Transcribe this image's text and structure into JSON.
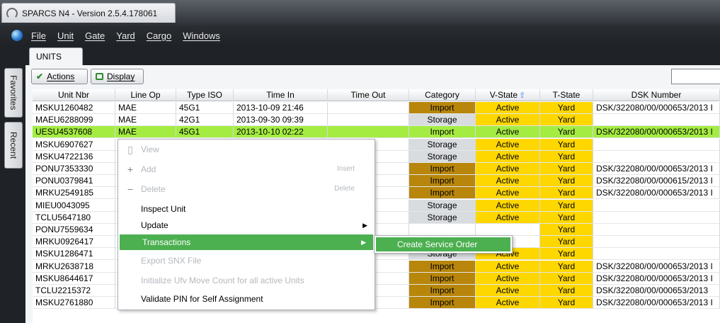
{
  "window": {
    "title": "SPARCS N4 - Version 2.5.4.178061"
  },
  "menu": [
    "File",
    "Unit",
    "Gate",
    "Yard",
    "Cargo",
    "Windows"
  ],
  "side_tabs": [
    "Favorites",
    "Recent"
  ],
  "tab": "UNITS",
  "toolbar": {
    "actions": "Actions",
    "display": "Display",
    "search_value": ""
  },
  "columns": [
    "Unit Nbr",
    "Line Op",
    "Type ISO",
    "Time In",
    "Time Out",
    "Category",
    "V-State",
    "T-State",
    "DSK Number"
  ],
  "colors": {
    "import": "#b8860b",
    "storage": "#d9dcdf",
    "active": "#ffd700",
    "selection": "#a4ec42",
    "highlight": "#4caf50"
  },
  "rows": [
    [
      "MSKU1260482",
      "MAE",
      "45G1",
      "2013-10-09 21:46",
      "",
      "Import",
      "Active",
      "Yard",
      "DSK/322080/00/000653/2013 I"
    ],
    [
      "MAEU6288099",
      "MAE",
      "42G1",
      "2013-09-30 09:39",
      "",
      "Storage",
      "Active",
      "Yard",
      ""
    ],
    [
      "UESU4537608",
      "MAE",
      "45G1",
      "2013-10-10 02:22",
      "",
      "Import",
      "Active",
      "Yard",
      "DSK/322080/00/000653/2013 I"
    ],
    [
      "MSKU6907627",
      "",
      "",
      "",
      "",
      "Storage",
      "Active",
      "Yard",
      ""
    ],
    [
      "MSKU4722136",
      "",
      "",
      "",
      "",
      "Storage",
      "Active",
      "Yard",
      ""
    ],
    [
      "PONU7353330",
      "",
      "",
      "",
      "",
      "Import",
      "Active",
      "Yard",
      "DSK/322080/00/000653/2013 I"
    ],
    [
      "PONU0379841",
      "",
      "",
      "",
      "",
      "Import",
      "Active",
      "Yard",
      "DSK/322080/00/000615/2013 I"
    ],
    [
      "MRKU2549185",
      "",
      "",
      "",
      "",
      "Import",
      "Active",
      "Yard",
      "DSK/322080/00/000653/2013 I"
    ],
    [
      "MIEU0043095",
      "",
      "",
      "",
      "",
      "Storage",
      "Active",
      "Yard",
      ""
    ],
    [
      "TCLU5647180",
      "",
      "",
      "",
      "",
      "Storage",
      "Active",
      "Yard",
      ""
    ],
    [
      "PONU7559634",
      "",
      "",
      "",
      "",
      "",
      "",
      "Yard",
      ""
    ],
    [
      "MRKU0926417",
      "",
      "",
      "",
      "",
      "",
      "",
      "Yard",
      ""
    ],
    [
      "MSKU1286471",
      "",
      "",
      "",
      "",
      "Storage",
      "Active",
      "Yard",
      ""
    ],
    [
      "MRKU2638718",
      "",
      "",
      "",
      "",
      "Import",
      "Active",
      "Yard",
      "DSK/322080/00/000653/2013 I"
    ],
    [
      "MSKU8644617",
      "",
      "",
      "",
      "",
      "Import",
      "Active",
      "Yard",
      "DSK/322080/00/000653/2013 I"
    ],
    [
      "TCLU2215372",
      "",
      "",
      "",
      "",
      "Import",
      "Active",
      "Yard",
      "DSK/322080/00/000653/2013"
    ],
    [
      "MSKU2761880",
      "MAE",
      "22G1",
      "2013-10-10 03:46",
      "",
      "Import",
      "Active",
      "Yard",
      "DSK/322080/00/000653/2013 I"
    ]
  ],
  "context_menu": {
    "view": "View",
    "add": "Add",
    "add_shortcut": "Insert",
    "delete": "Delete",
    "delete_shortcut": "Delete",
    "inspect": "Inspect Unit",
    "update": "Update",
    "transactions": "Transactions",
    "export": "Export SNX File",
    "initialize": "Initialize Ufv Move Count for all active Units",
    "validate": "Validate  PIN for Self Assignment"
  },
  "submenu": {
    "create_service_order": "Create Service Order"
  }
}
